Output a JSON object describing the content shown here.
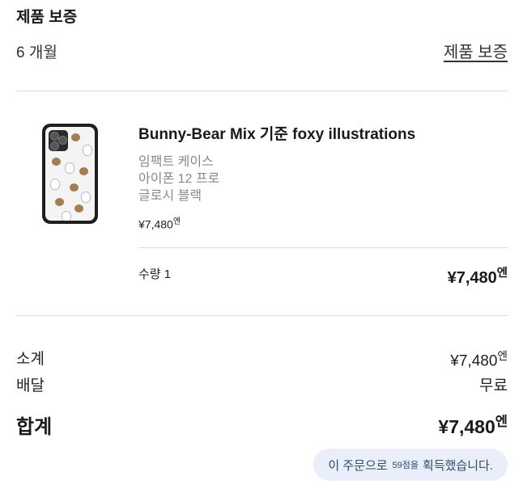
{
  "warranty": {
    "title": "제품 보증",
    "value": "6 개월",
    "link_label": "제품 보증"
  },
  "product": {
    "name": "Bunny-Bear Mix 기준 foxy illustrations",
    "options": [
      "임팩트 케이스",
      "아이폰 12 프로",
      "글로시 블랙"
    ],
    "unit_price": "¥7,480",
    "unit_price_suffix": "엔",
    "quantity_label": "수량 1",
    "line_total": "¥7,480",
    "line_total_suffix": "엔",
    "image_icon": "phone-case-thumbnail"
  },
  "summary": {
    "subtotal_label": "소계",
    "subtotal_value": "¥7,480",
    "subtotal_suffix": "엔",
    "shipping_label": "배달",
    "shipping_value": "무료",
    "total_label": "합계",
    "total_value": "¥7,480",
    "total_suffix": "엔"
  },
  "points": {
    "prefix": "이 주문으로",
    "amount": "59점을",
    "suffix": "획득했습니다."
  },
  "colors": {
    "divider": "#dcdcdc",
    "muted_text": "#8a8a8a",
    "badge_bg": "#e9eef8",
    "badge_text": "#2f4a6d"
  }
}
